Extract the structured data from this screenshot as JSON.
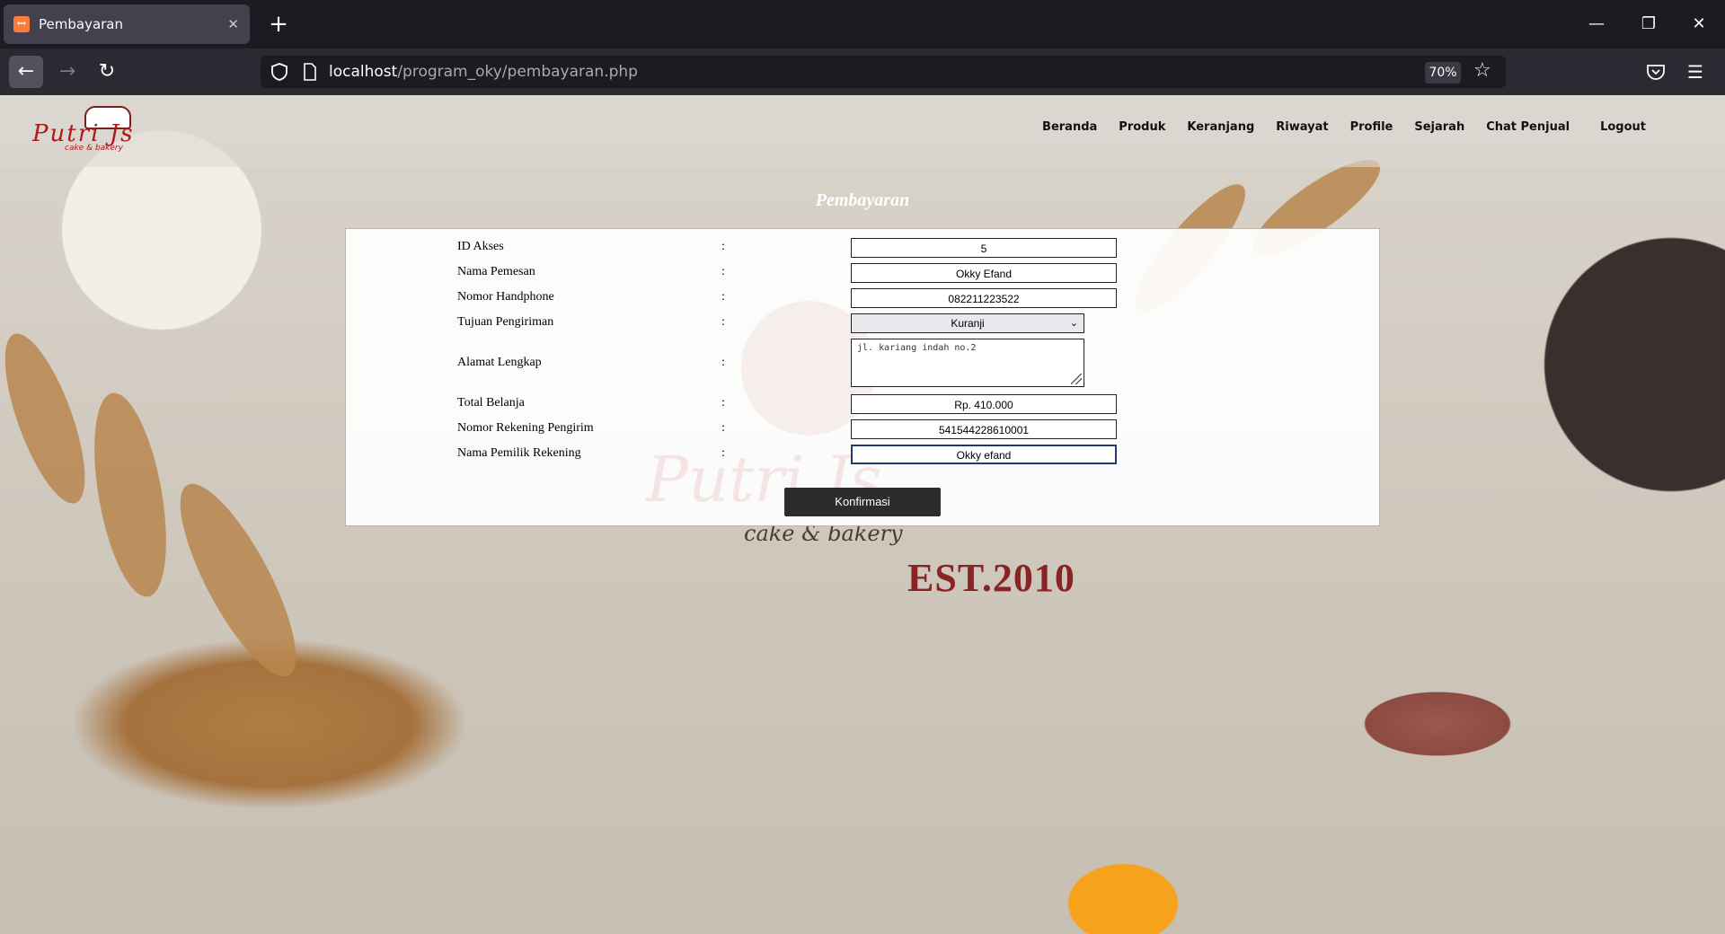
{
  "browser": {
    "tab_title": "Pembayaran",
    "tab_favicon": "xampp-favicon",
    "url_host": "localhost",
    "url_path": "/program_oky/pembayaran.php",
    "zoom": "70%"
  },
  "header": {
    "logo_brand": "Putri Js",
    "logo_sub": "cake & bakery",
    "menu": [
      "Beranda",
      "Produk",
      "Keranjang",
      "Riwayat",
      "Profile",
      "Sejarah",
      "Chat Penjual",
      "Logout"
    ]
  },
  "page": {
    "title": "Pembayaran",
    "bg_tagline": "cake & bakery",
    "bg_est": "EST.2010",
    "watermark": "Putri Js"
  },
  "form": {
    "separator": ":",
    "fields": [
      {
        "label": "ID Akses",
        "value": "5"
      },
      {
        "label": "Nama Pemesan",
        "value": "Okky Efand"
      },
      {
        "label": "Nomor Handphone",
        "value": "082211223522"
      },
      {
        "label": "Tujuan Pengiriman",
        "value": "Kuranji"
      },
      {
        "label": "Alamat Lengkap",
        "value": "jl. kariang indah no.2"
      },
      {
        "label": "Total Belanja",
        "value": "Rp. 410.000"
      },
      {
        "label": "Nomor Rekening Pengirim",
        "value": "541544228610001"
      },
      {
        "label": "Nama Pemilik Rekening",
        "value": "Okky efand"
      }
    ],
    "submit_label": "Konfirmasi"
  }
}
